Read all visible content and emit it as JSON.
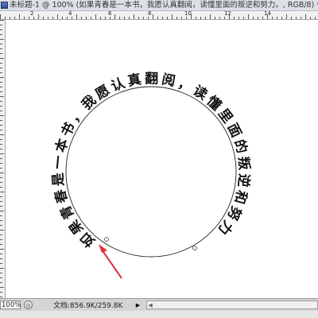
{
  "window": {
    "title": "未标题-1 @ 100% (如果青春是一本书，我愿认真翻阅，读懂里面的叛逆和努力。, RGB/8) *"
  },
  "ruler": {
    "top_labels": [
      "2",
      "4",
      "6",
      "8",
      "10",
      "12",
      "14"
    ]
  },
  "canvas": {
    "path_text": "如果青春是一本书，我愿认真翻阅，读懂里面的叛逆和努力",
    "text_color": "#111111",
    "circle_color": "#222222",
    "annotation_arrow_color": "#e0303a"
  },
  "statusbar": {
    "zoom": "100%",
    "doc_info": "文档:856.9K/259.8K"
  },
  "icons": {
    "title": "photoshop-document-icon",
    "status": "zoom-indicator-icon",
    "expand": "right-triangle-icon"
  }
}
